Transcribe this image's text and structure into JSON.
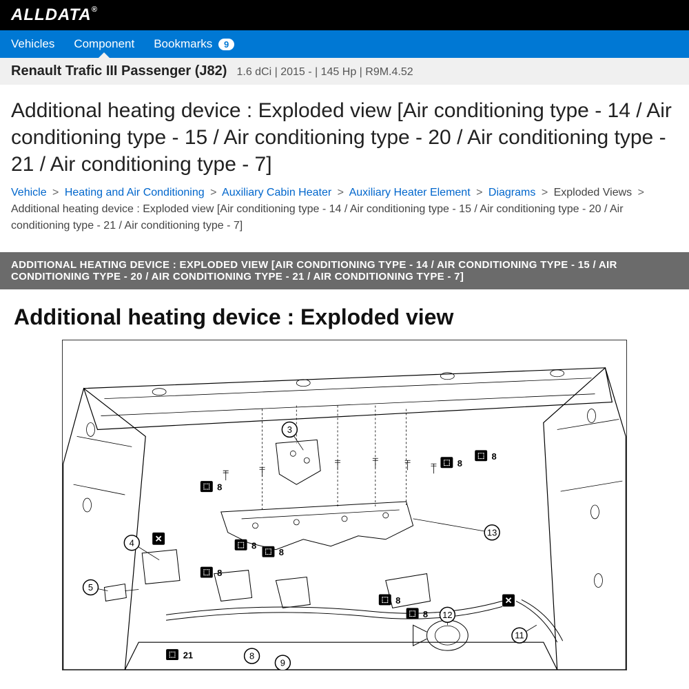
{
  "header": {
    "logo": "ALLDATA",
    "logo_reg": "®"
  },
  "nav": {
    "vehicles": "Vehicles",
    "component": "Component",
    "bookmarks": "Bookmarks",
    "bookmarks_count": "9"
  },
  "vehicle": {
    "name": "Renault Trafic III Passenger (J82)",
    "details": "1.6 dCi | 2015 - | 145 Hp | R9M.4.52"
  },
  "page_title": "Additional heating device : Exploded view [Air conditioning type - 14 / Air conditioning type - 15 / Air conditioning type - 20 / Air conditioning type - 21 / Air conditioning type - 7]",
  "breadcrumb": {
    "vehicle": "Vehicle",
    "heating": "Heating and Air Conditioning",
    "aux_cabin": "Auxiliary Cabin Heater",
    "aux_element": "Auxiliary Heater Element",
    "diagrams": "Diagrams",
    "exploded": "Exploded Views",
    "current": "Additional heating device : Exploded view [Air conditioning type - 14 / Air conditioning type - 15 / Air conditioning type - 20 / Air conditioning type - 21 / Air conditioning type - 7]"
  },
  "gray_banner": "ADDITIONAL HEATING DEVICE : EXPLODED VIEW [AIR CONDITIONING TYPE - 14 / AIR CONDITIONING TYPE - 15 / AIR CONDITIONING TYPE - 20 / AIR CONDITIONING TYPE - 21 / AIR CONDITIONING TYPE - 7]",
  "content_heading": "Additional heating device : Exploded view",
  "diagram": {
    "callouts": [
      "3",
      "4",
      "5",
      "8",
      "9",
      "11",
      "12",
      "13"
    ],
    "torque_values": [
      "8",
      "8",
      "8",
      "8",
      "8",
      "8",
      "8",
      "8",
      "21"
    ]
  }
}
